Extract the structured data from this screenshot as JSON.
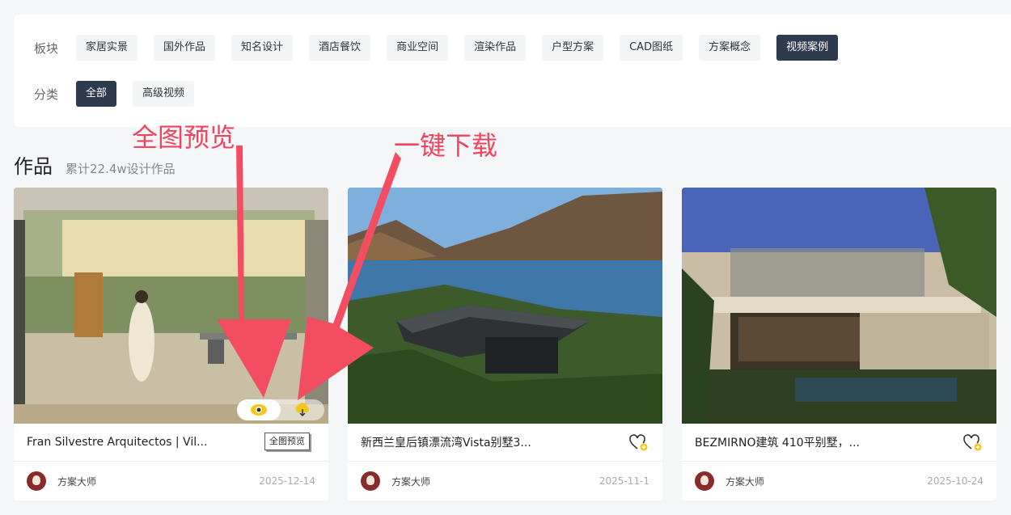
{
  "filters": {
    "row1_label": "板块",
    "row1_chips": [
      "家居实景",
      "国外作品",
      "知名设计",
      "酒店餐饮",
      "商业空间",
      "渲染作品",
      "户型方案",
      "CAD图纸",
      "方案概念",
      "视频案例"
    ],
    "row1_active": "视频案例",
    "row2_label": "分类",
    "row2_chips": [
      "全部",
      "高级视频"
    ],
    "row2_active": "全部"
  },
  "section": {
    "title": "作品",
    "subtitle": "累计22.4w设计作品"
  },
  "cards": [
    {
      "title": "Fran Silvestre Arquitectos | Vil...",
      "author": "方案大师",
      "date": "2025-12-14"
    },
    {
      "title": "新西兰皇后镇漂流湾Vista别墅3...",
      "author": "方案大师",
      "date": "2025-11-1"
    },
    {
      "title": "BEZMIRNO建筑 410平别墅，...",
      "author": "方案大师",
      "date": "2025-10-24"
    }
  ],
  "tooltip": "全图预览",
  "annotations": {
    "preview": "全图预览",
    "download": "一键下载"
  },
  "colors": {
    "accent_active": "#2e3a4e",
    "annotation_red": "#f0445e",
    "icon_yellow": "#f5c518"
  },
  "icons": {
    "preview": "eye-icon",
    "download": "cloud-download-icon",
    "favorite": "heart-plus-icon"
  }
}
